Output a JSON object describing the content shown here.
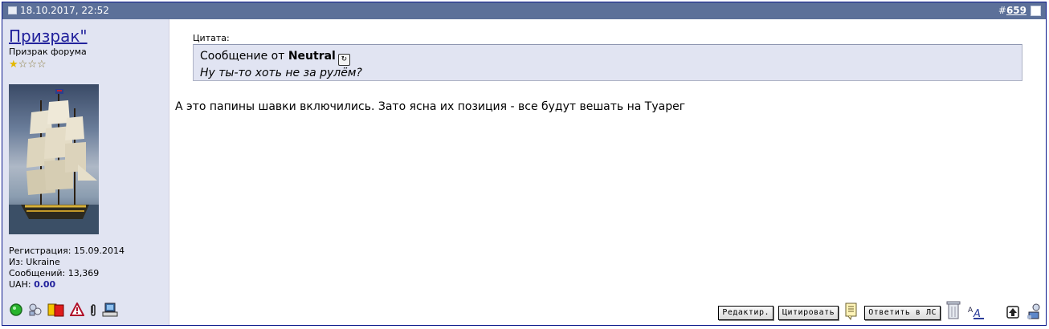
{
  "post": {
    "date": "18.10.2017, 22:52",
    "number_prefix": "#",
    "number": "659"
  },
  "user": {
    "name": "Призрак\"",
    "title": "Призрак форума",
    "stars": 4,
    "registration": "Регистрация: 15.09.2014",
    "location": "Из: Ukraine",
    "posts": "Сообщений: 13,369",
    "uah_label": "UAH: ",
    "uah_value": "0.00"
  },
  "quote": {
    "label": "Цитата:",
    "from_prefix": "Сообщение от ",
    "author": "Neutral",
    "text": "Ну ты-то хоть не за рулём?"
  },
  "message": "А это папины шавки включились. Зато ясна их позиция - все будут вешать на Туарег",
  "buttons": {
    "edit": "Редактир.",
    "quote": "Цитировать",
    "reply_pm": "Ответить в ЛС"
  },
  "icons": {
    "status": "online-status-icon",
    "profile": "profile-icon",
    "card": "yellow-red-card-icon",
    "report": "report-warning-icon",
    "attach": "paperclip-icon",
    "computer": "computer-icon"
  }
}
